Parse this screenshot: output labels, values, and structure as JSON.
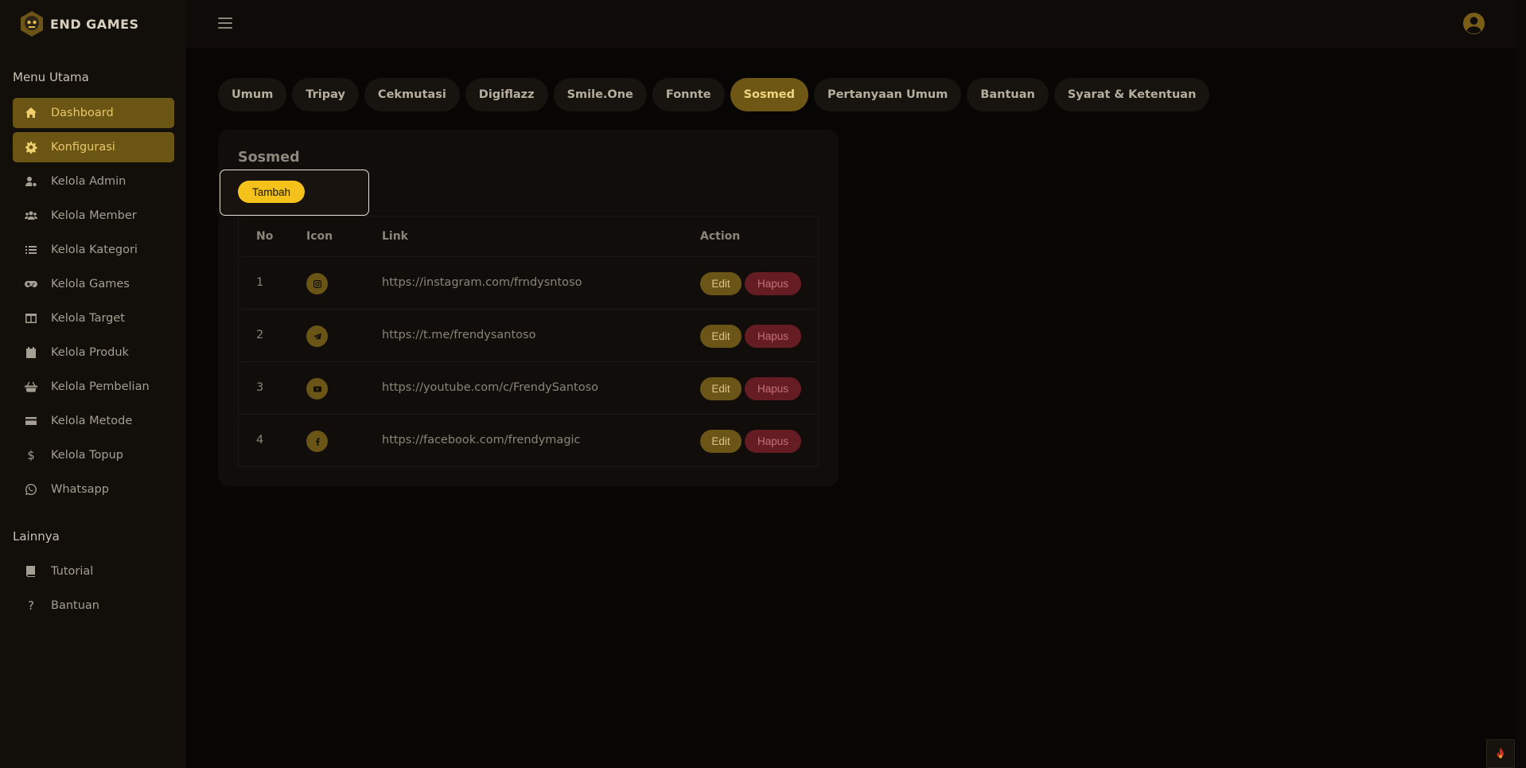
{
  "brand": {
    "name": "END GAMES"
  },
  "sidebar": {
    "section_main": "Menu Utama",
    "section_other": "Lainnya",
    "items": [
      {
        "label": "Dashboard",
        "icon": "home-icon",
        "active": true
      },
      {
        "label": "Konfigurasi",
        "icon": "gear-icon",
        "active": true
      },
      {
        "label": "Kelola Admin",
        "icon": "user-gear-icon",
        "active": false
      },
      {
        "label": "Kelola Member",
        "icon": "users-icon",
        "active": false
      },
      {
        "label": "Kelola Kategori",
        "icon": "list-icon",
        "active": false
      },
      {
        "label": "Kelola Games",
        "icon": "gamepad-icon",
        "active": false
      },
      {
        "label": "Kelola Target",
        "icon": "table-icon",
        "active": false
      },
      {
        "label": "Kelola Produk",
        "icon": "calendar-icon",
        "active": false
      },
      {
        "label": "Kelola Pembelian",
        "icon": "basket-icon",
        "active": false
      },
      {
        "label": "Kelola Metode",
        "icon": "credit-card-icon",
        "active": false
      },
      {
        "label": "Kelola Topup",
        "icon": "dollar-icon",
        "active": false
      },
      {
        "label": "Whatsapp",
        "icon": "whatsapp-icon",
        "active": false
      }
    ],
    "other_items": [
      {
        "label": "Tutorial",
        "icon": "book-icon"
      },
      {
        "label": "Bantuan",
        "icon": "question-icon"
      }
    ]
  },
  "tabs": [
    {
      "label": "Umum",
      "active": false
    },
    {
      "label": "Tripay",
      "active": false
    },
    {
      "label": "Cekmutasi",
      "active": false
    },
    {
      "label": "Digiflazz",
      "active": false
    },
    {
      "label": "Smile.One",
      "active": false
    },
    {
      "label": "Fonnte",
      "active": false
    },
    {
      "label": "Sosmed",
      "active": true
    },
    {
      "label": "Pertanyaan Umum",
      "active": false
    },
    {
      "label": "Bantuan",
      "active": false
    },
    {
      "label": "Syarat & Ketentuan",
      "active": false
    }
  ],
  "card": {
    "title": "Sosmed",
    "add_label": "Tambah",
    "columns": [
      "No",
      "Icon",
      "Link",
      "Action"
    ],
    "edit_label": "Edit",
    "delete_label": "Hapus",
    "rows": [
      {
        "no": "1",
        "icon": "instagram-icon",
        "link": "https://instagram.com/frndysntoso"
      },
      {
        "no": "2",
        "icon": "telegram-icon",
        "link": "https://t.me/frendysantoso"
      },
      {
        "no": "3",
        "icon": "youtube-icon",
        "link": "https://youtube.com/c/FrendySantoso"
      },
      {
        "no": "4",
        "icon": "facebook-icon",
        "link": "https://facebook.com/frendymagic"
      }
    ]
  },
  "colors": {
    "accent": "#f4c21a",
    "accent_dim": "#6b5514",
    "danger_dim": "#651c22",
    "background": "#080604",
    "sidebar": "#120f0b"
  }
}
